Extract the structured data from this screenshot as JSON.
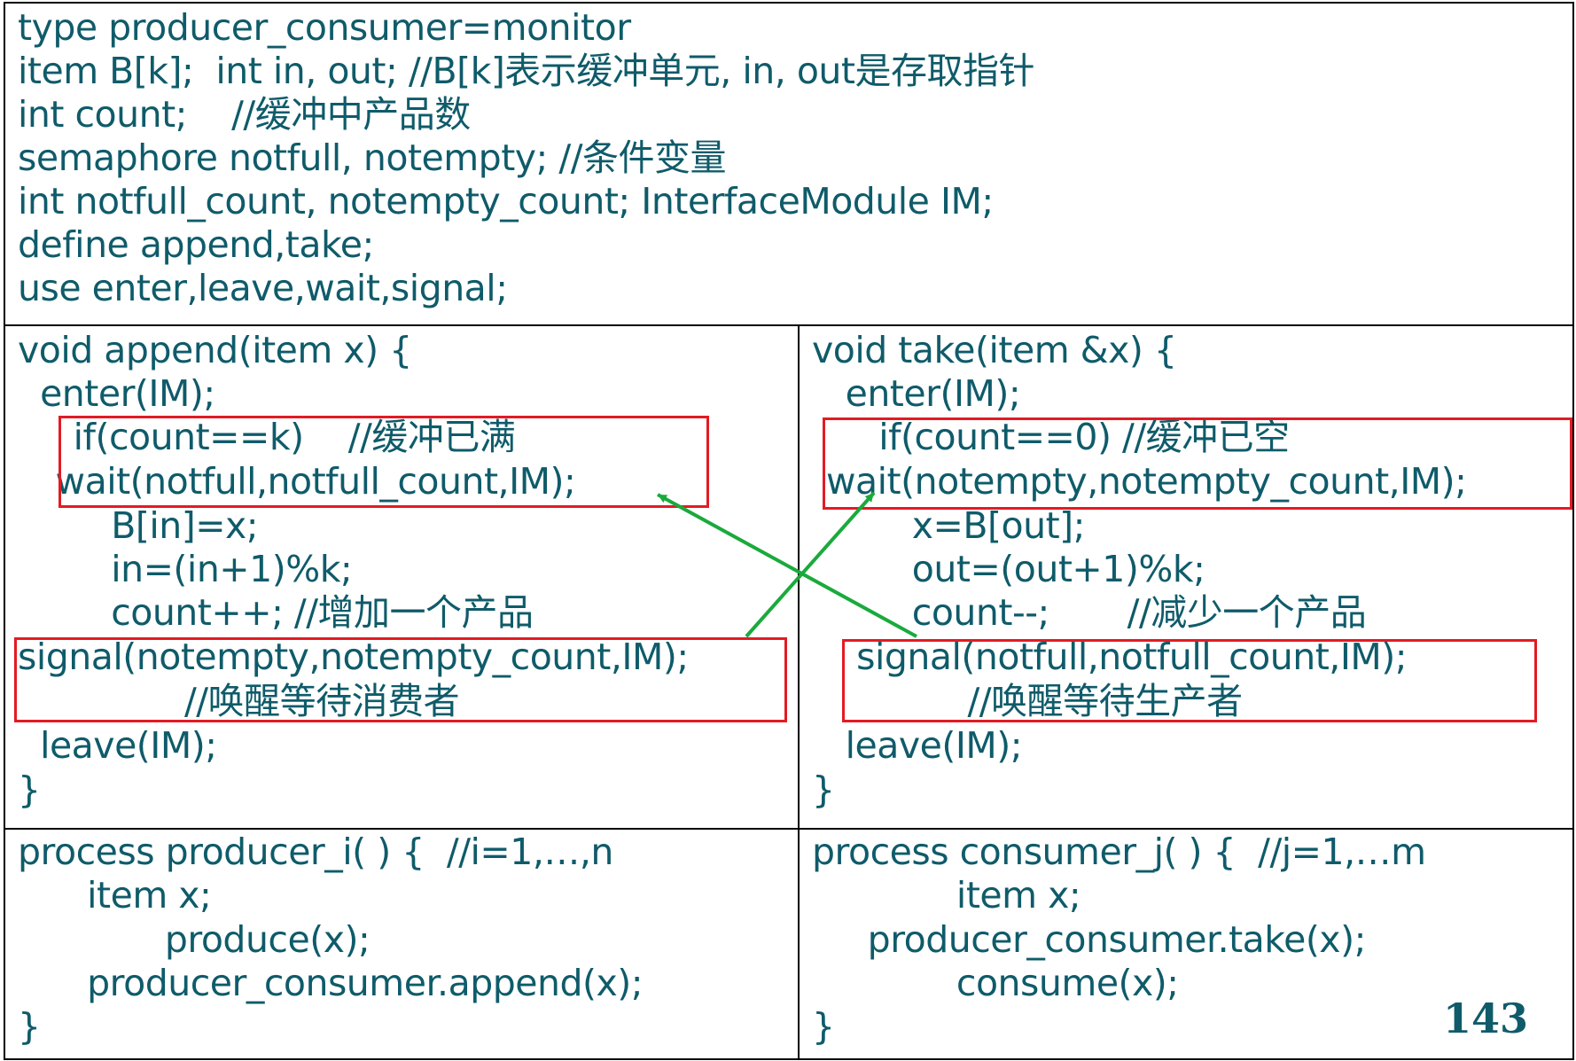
{
  "colors": {
    "text": "#0f5b6a",
    "highlight_box": "#e31b23",
    "arrow": "#1aaa3c",
    "grid": "#000000"
  },
  "declarations": {
    "lines": [
      "type producer_consumer=monitor",
      "item B[k];  int in, out; //B[k]表示缓冲单元, in, out是存取指针",
      "int count;    //缓冲中产品数",
      "semaphore notfull, notempty; //条件变量",
      "int notfull_count, notempty_count; InterfaceModule IM;",
      "define append,take;",
      "use enter,leave,wait,signal;"
    ]
  },
  "append": {
    "lines": [
      "void append(item x) {",
      "  enter(IM);",
      "     if(count==k)    //缓冲已满",
      " wait(notfull,notfull_count,IM);",
      "      B[in]=x;",
      "      in=(in+1)%k;",
      "      count++; //增加一个产品",
      "signal(notempty,notempty_count,IM);",
      "               //唤醒等待消费者",
      "  leave(IM);",
      "}"
    ]
  },
  "take": {
    "lines": [
      "void take(item &x) {",
      "   enter(IM);",
      "      if(count==0) //缓冲已空",
      "wait(notempty,notempty_count,IM);",
      "         x=B[out];",
      "         out=(out+1)%k;",
      "         count--;       //减少一个产品",
      "    signal(notfull,notfull_count,IM);",
      "              //唤醒等待生产者",
      "   leave(IM);",
      "}"
    ]
  },
  "producer": {
    "lines": [
      "process producer_i( ) {  //i=1,…,n",
      "    item x;",
      "           produce(x);",
      "    producer_consumer.append(x);",
      "}"
    ]
  },
  "consumer": {
    "lines": [
      "process consumer_j( ) {  //j=1,…m",
      "             item x;",
      "     producer_consumer.take(x);",
      "             consume(x);",
      "}"
    ]
  },
  "page_number": "143"
}
